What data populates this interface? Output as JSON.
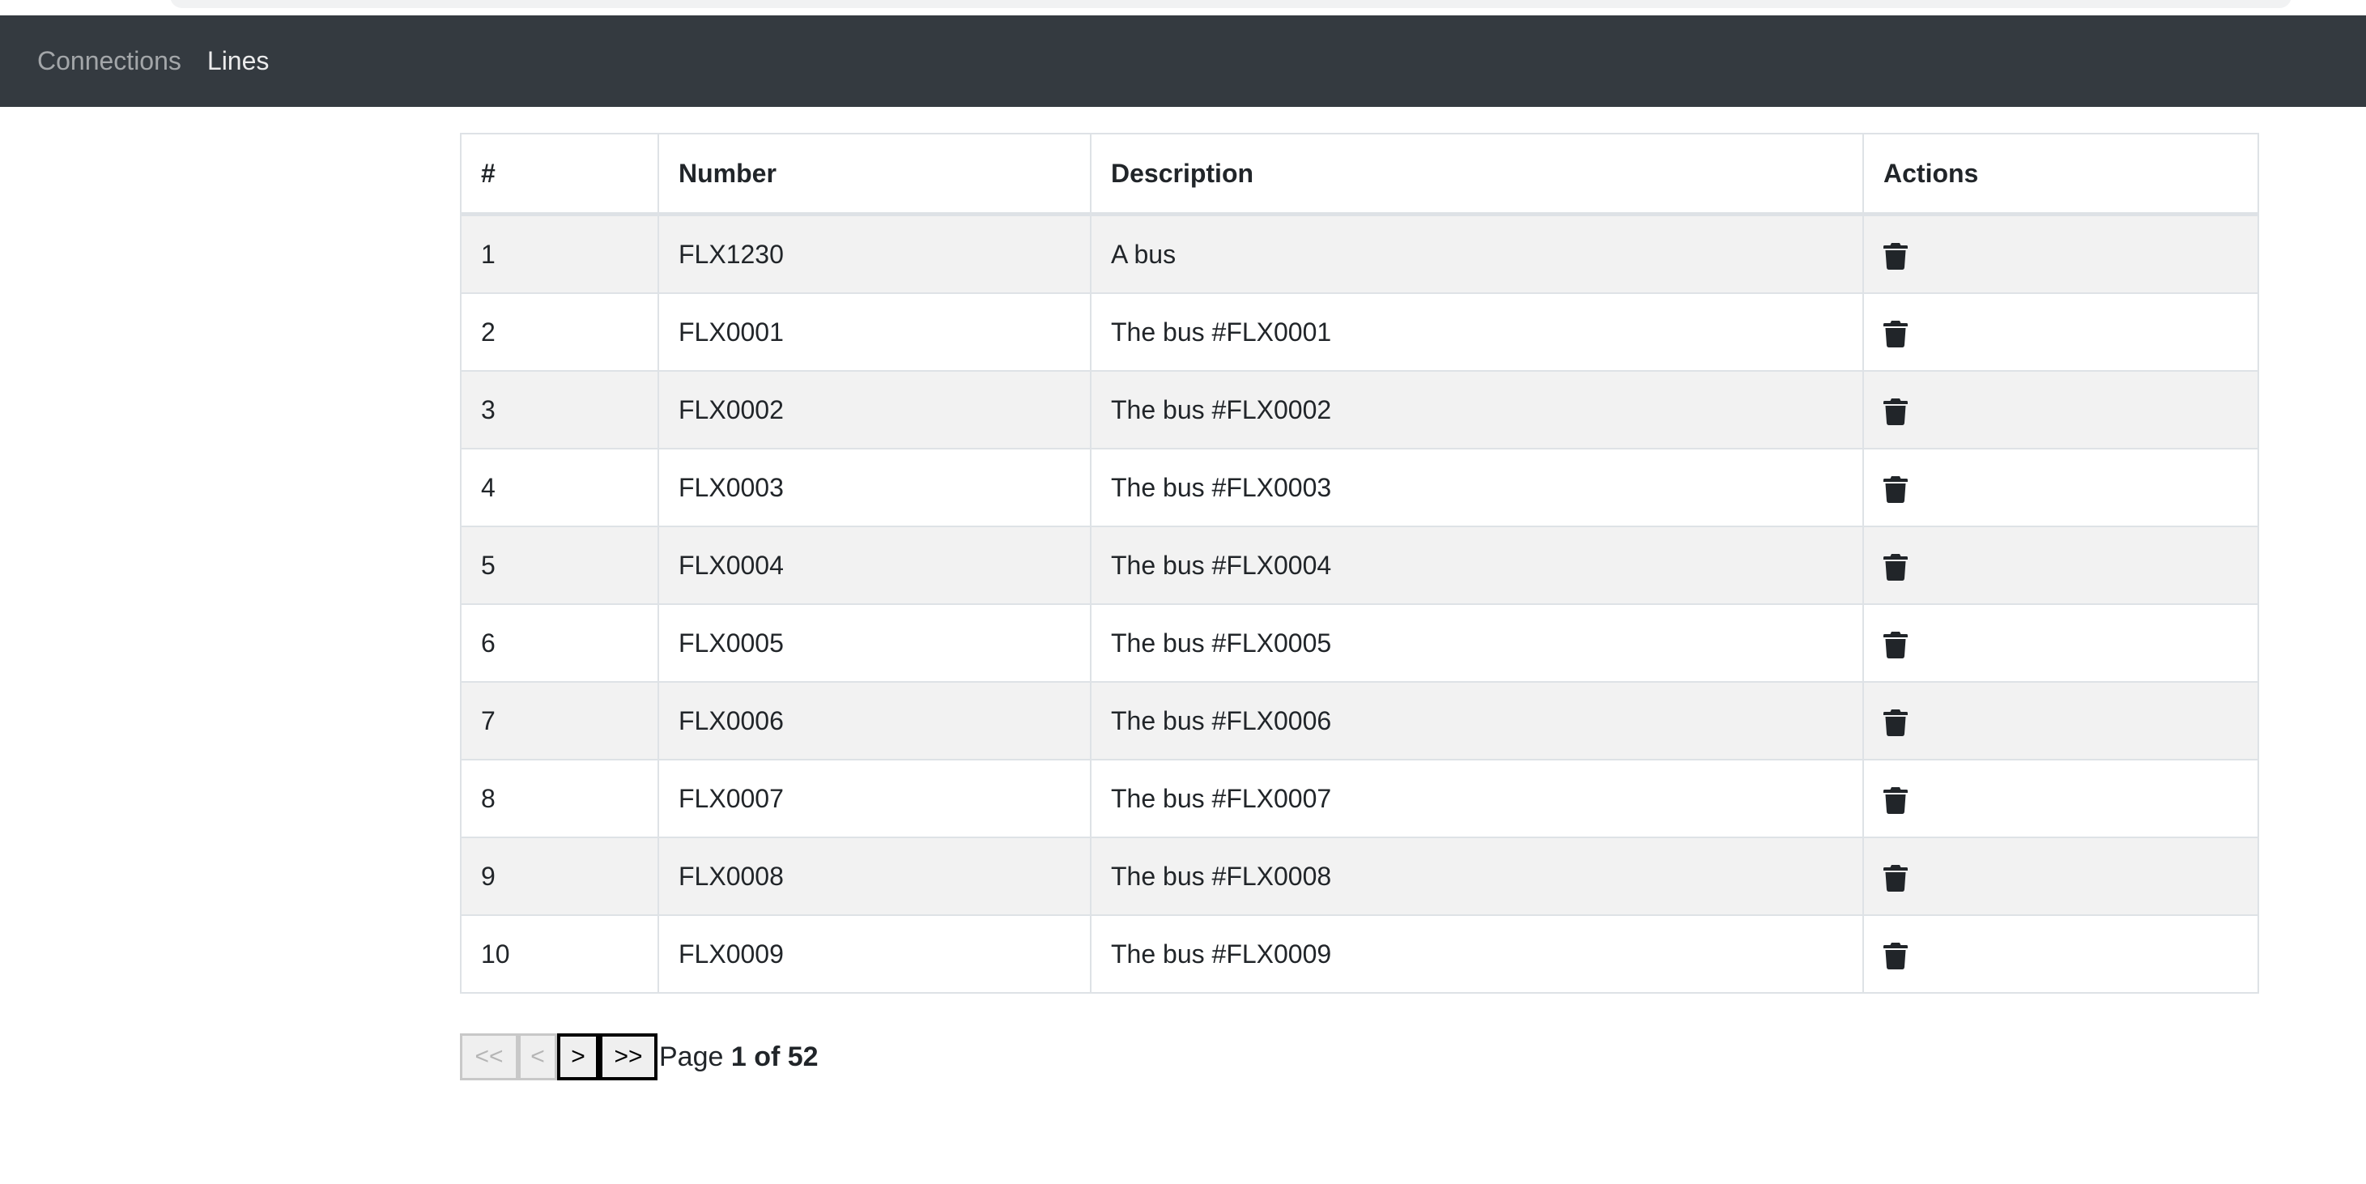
{
  "nav": {
    "items": [
      {
        "label": "Connections"
      },
      {
        "label": "Lines"
      }
    ]
  },
  "table": {
    "headers": [
      "#",
      "Number",
      "Description",
      "Actions"
    ],
    "rows": [
      {
        "index": "1",
        "number": "FLX1230",
        "description": "A bus",
        "action_icon": "trash-icon"
      },
      {
        "index": "2",
        "number": "FLX0001",
        "description": "The bus #FLX0001",
        "action_icon": "trash-icon"
      },
      {
        "index": "3",
        "number": "FLX0002",
        "description": "The bus #FLX0002",
        "action_icon": "trash-icon"
      },
      {
        "index": "4",
        "number": "FLX0003",
        "description": "The bus #FLX0003",
        "action_icon": "trash-icon"
      },
      {
        "index": "5",
        "number": "FLX0004",
        "description": "The bus #FLX0004",
        "action_icon": "trash-icon"
      },
      {
        "index": "6",
        "number": "FLX0005",
        "description": "The bus #FLX0005",
        "action_icon": "trash-icon"
      },
      {
        "index": "7",
        "number": "FLX0006",
        "description": "The bus #FLX0006",
        "action_icon": "trash-icon"
      },
      {
        "index": "8",
        "number": "FLX0007",
        "description": "The bus #FLX0007",
        "action_icon": "trash-icon"
      },
      {
        "index": "9",
        "number": "FLX0008",
        "description": "The bus #FLX0008",
        "action_icon": "trash-icon"
      },
      {
        "index": "10",
        "number": "FLX0009",
        "description": "The bus #FLX0009",
        "action_icon": "trash-icon"
      }
    ]
  },
  "pagination": {
    "first_label": "<<",
    "prev_label": "<",
    "next_label": ">",
    "last_label": ">>",
    "page_prefix": "Page",
    "page_status": "1 of 52"
  },
  "colors": {
    "navbar_bg": "#343a40",
    "striped_row_bg": "#f2f2f2",
    "border": "#dee2e6"
  }
}
